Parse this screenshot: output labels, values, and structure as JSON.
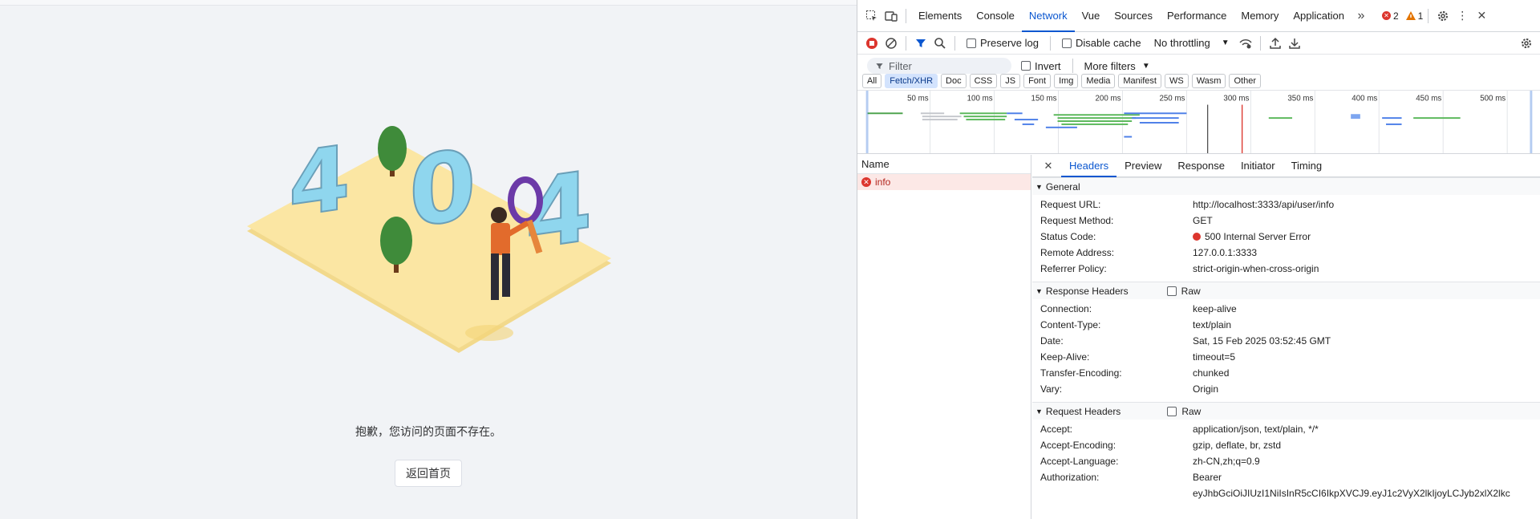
{
  "page": {
    "message": "抱歉，您访问的页面不存在。",
    "home_button": "返回首页"
  },
  "devtools": {
    "tabs": [
      "Elements",
      "Console",
      "Network",
      "Vue",
      "Sources",
      "Performance",
      "Memory",
      "Application"
    ],
    "active_tab": "Network",
    "error_count": "2",
    "warning_count": "1",
    "toolbar": {
      "preserve_log": "Preserve log",
      "disable_cache": "Disable cache",
      "throttling": "No throttling"
    },
    "filter": {
      "placeholder": "Filter",
      "invert": "Invert",
      "more_filters": "More filters"
    },
    "type_filters": [
      "All",
      "Fetch/XHR",
      "Doc",
      "CSS",
      "JS",
      "Font",
      "Img",
      "Media",
      "Manifest",
      "WS",
      "Wasm",
      "Other"
    ],
    "active_type": "Fetch/XHR",
    "timeline_ticks": [
      "50 ms",
      "100 ms",
      "150 ms",
      "200 ms",
      "250 ms",
      "300 ms",
      "350 ms",
      "400 ms",
      "450 ms",
      "500 ms"
    ],
    "name_header": "Name",
    "requests": [
      {
        "name": "info",
        "status": "error"
      }
    ],
    "detail_tabs": [
      "Headers",
      "Preview",
      "Response",
      "Initiator",
      "Timing"
    ],
    "active_detail_tab": "Headers",
    "general": {
      "title": "General",
      "rows": [
        {
          "k": "Request URL:",
          "v": "http://localhost:3333/api/user/info"
        },
        {
          "k": "Request Method:",
          "v": "GET"
        },
        {
          "k": "Status Code:",
          "v": "500 Internal Server Error"
        },
        {
          "k": "Remote Address:",
          "v": "127.0.0.1:3333"
        },
        {
          "k": "Referrer Policy:",
          "v": "strict-origin-when-cross-origin"
        }
      ]
    },
    "response_headers": {
      "title": "Response Headers",
      "raw": "Raw",
      "rows": [
        {
          "k": "Connection:",
          "v": "keep-alive"
        },
        {
          "k": "Content-Type:",
          "v": "text/plain"
        },
        {
          "k": "Date:",
          "v": "Sat, 15 Feb 2025 03:52:45 GMT"
        },
        {
          "k": "Keep-Alive:",
          "v": "timeout=5"
        },
        {
          "k": "Transfer-Encoding:",
          "v": "chunked"
        },
        {
          "k": "Vary:",
          "v": "Origin"
        }
      ]
    },
    "request_headers": {
      "title": "Request Headers",
      "raw": "Raw",
      "rows": [
        {
          "k": "Accept:",
          "v": "application/json, text/plain, */*"
        },
        {
          "k": "Accept-Encoding:",
          "v": "gzip, deflate, br, zstd"
        },
        {
          "k": "Accept-Language:",
          "v": "zh-CN,zh;q=0.9"
        },
        {
          "k": "Authorization:",
          "v": "Bearer"
        },
        {
          "k": "",
          "v": "eyJhbGciOiJIUzI1NiIsInR5cCI6IkpXVCJ9.eyJ1c2VyX2lkIjoyLCJyb2xlX2lkc"
        }
      ]
    }
  }
}
